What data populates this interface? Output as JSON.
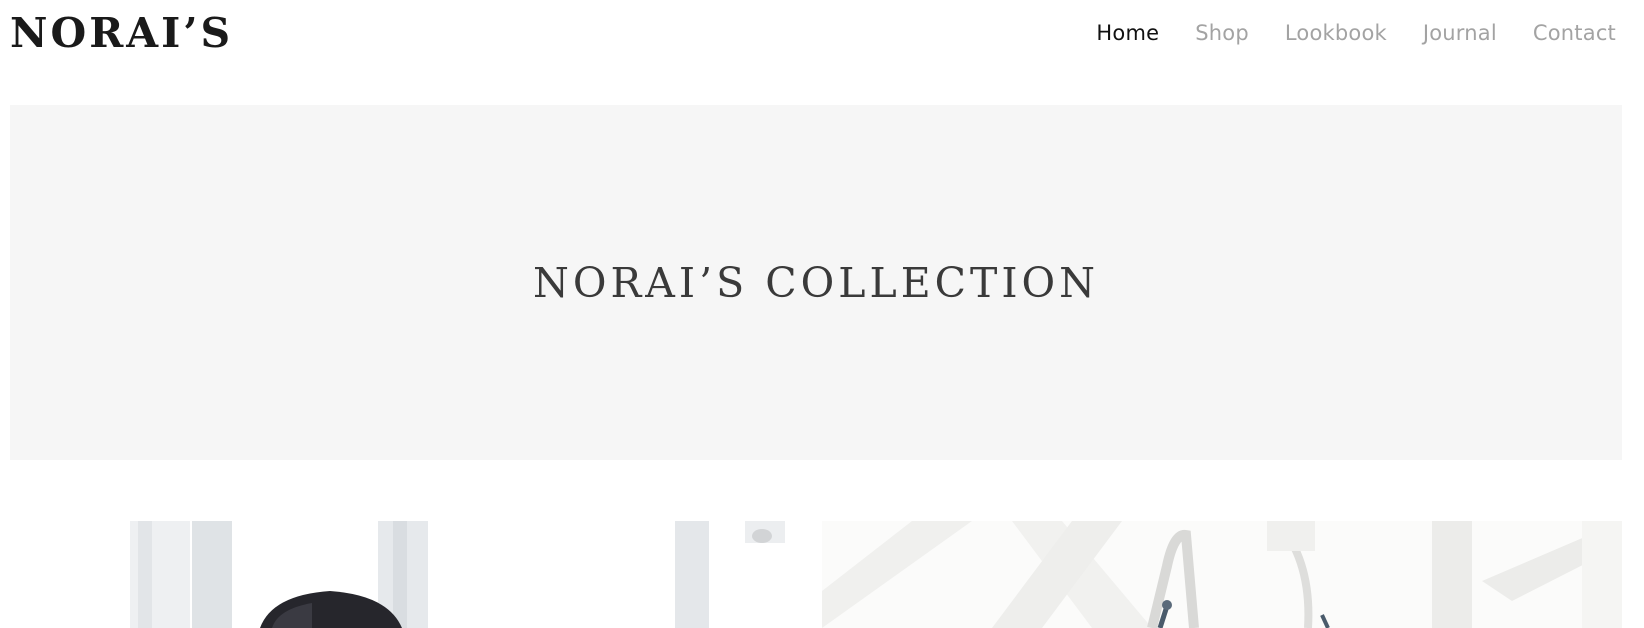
{
  "header": {
    "logo": "NORAI’S",
    "nav": [
      {
        "label": "Home",
        "active": true
      },
      {
        "label": "Shop",
        "active": false
      },
      {
        "label": "Lookbook",
        "active": false
      },
      {
        "label": "Journal",
        "active": false
      },
      {
        "label": "Contact",
        "active": false
      }
    ]
  },
  "hero": {
    "title": "NORAI’S COLLECTION"
  },
  "gallery": [
    {
      "name": "lookbook-photo-model"
    },
    {
      "name": "lookbook-photo-bag"
    }
  ],
  "colors": {
    "nav_active": "#111111",
    "nav_inactive": "#a3a3a3",
    "hero_background": "#f6f6f6",
    "hero_text": "#3a3a3a"
  }
}
